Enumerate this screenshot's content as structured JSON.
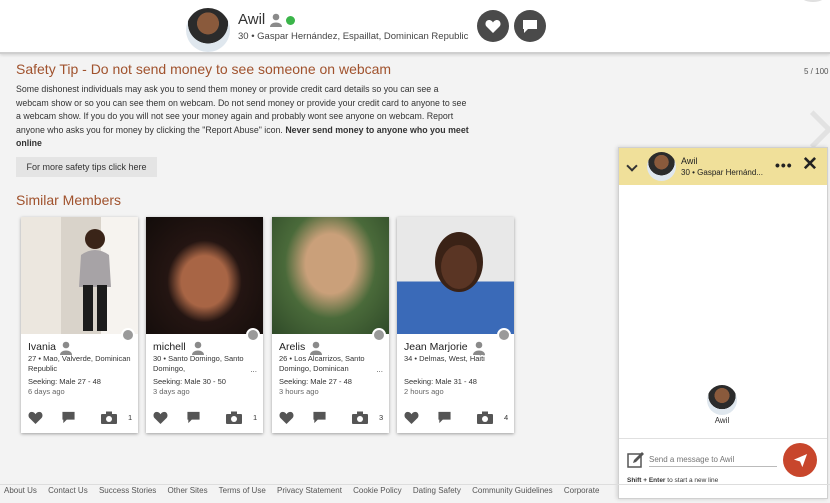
{
  "header": {
    "name": "Awil",
    "location": "30 • Gaspar Hernández, Espaillat, Dominican Republic"
  },
  "pagination": "5 / 100",
  "safety": {
    "title": "Safety Tip - Do not send money to see someone on webcam",
    "body": "Some dishonest individuals may ask you to send them money or provide credit card details so you can see a webcam show or so you can see them on webcam. Do not send money or provide your credit card to anyone to see a webcam show. If you do you will not see your money again and probably wont see anyone on webcam. Report anyone who asks you for money by clicking the \"Report Abuse\" icon.",
    "body_bold": "Never send money to anyone who you meet online",
    "tips_button": "For more safety tips click here"
  },
  "similar": {
    "title": "Similar Members",
    "members": [
      {
        "name": "Ivania",
        "location": "27 • Mao, Valverde, Dominican Republic",
        "ellipsis": "",
        "seeking": "Seeking: Male 27 - 48",
        "last_seen": "6 days ago",
        "photo_count": "1"
      },
      {
        "name": "michell",
        "location": "30 • Santo Domingo, Santo Domingo,",
        "ellipsis": "...",
        "seeking": "Seeking: Male 30 - 50",
        "last_seen": "3 days ago",
        "photo_count": "1"
      },
      {
        "name": "Arelis",
        "location": "26 • Los Alcarrizos, Santo Domingo, Dominican",
        "ellipsis": "...",
        "seeking": "Seeking: Male 27 - 48",
        "last_seen": "3 hours ago",
        "photo_count": "3"
      },
      {
        "name": "Jean Marjorie",
        "location": "34 • Delmas, West, Haiti",
        "ellipsis": "",
        "seeking": "Seeking: Male 31 - 48",
        "last_seen": "2 hours ago",
        "photo_count": "4"
      }
    ]
  },
  "chat": {
    "name": "Awil",
    "location": "30 • Gaspar Hernánd...",
    "center_name": "Awil",
    "placeholder": "Send a message to Awil",
    "hint_bold": "Shift + Enter",
    "hint_rest": "to start a new line"
  },
  "footer": {
    "links": [
      "About Us",
      "Contact Us",
      "Success Stories",
      "Other Sites",
      "Terms of Use",
      "Privacy Statement",
      "Cookie Policy",
      "Dating Safety",
      "Community Guidelines",
      "Corporate"
    ]
  },
  "colors": {
    "accent": "#a0522d",
    "chat_header": "#f0e09a",
    "send": "#c8462c",
    "online": "#3bb54a"
  }
}
